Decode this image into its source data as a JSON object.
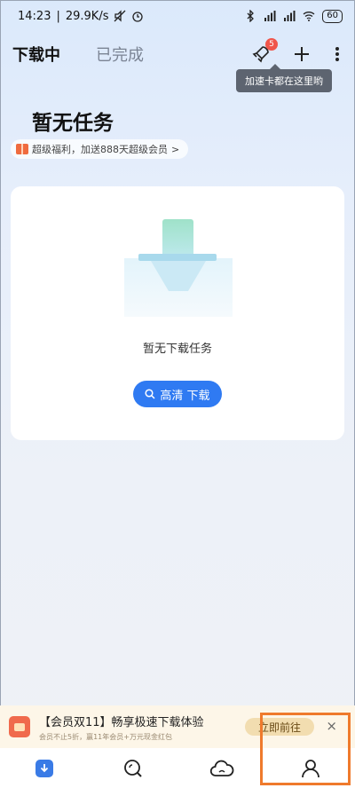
{
  "status_bar": {
    "time": "14:23",
    "speed": "29.9K/s",
    "battery": "60"
  },
  "header": {
    "tab_downloading": "下载中",
    "tab_completed": "已完成",
    "notify_badge": "5"
  },
  "tooltip": "加速卡都在这里哟",
  "empty": {
    "title": "暂无任务",
    "promo": "超级福利，加送888天超级会员",
    "promo_chevron": ">"
  },
  "card": {
    "text": "暂无下载任务",
    "button_label": "高清 下载"
  },
  "banner": {
    "title": "【会员双11】畅享极速下载体验",
    "subtitle": "会员不止5折，赢11年会员+万元现金红包",
    "go_label": "立即前往",
    "close": "×"
  },
  "colors": {
    "accent": "#2f7af2",
    "badge": "#f0554a",
    "highlight": "#ef7a2c"
  },
  "icons": {
    "nav": [
      "download-icon",
      "search-icon",
      "cloud-icon",
      "profile-icon"
    ]
  }
}
